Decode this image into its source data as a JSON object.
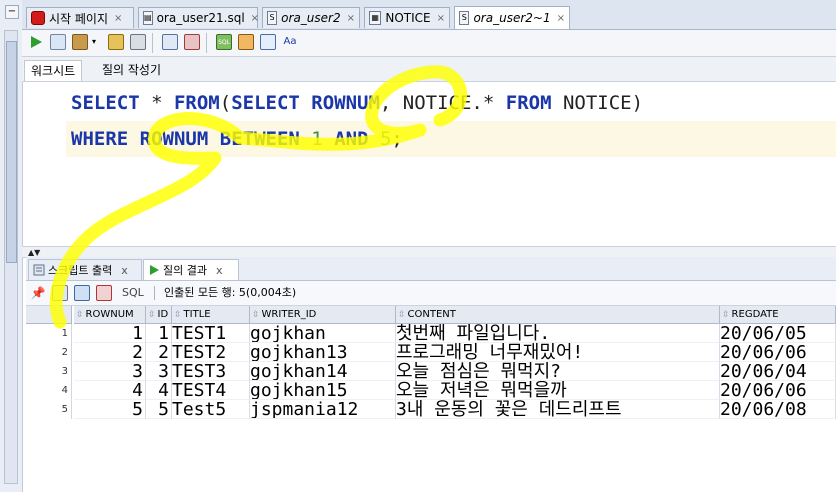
{
  "tabs": [
    {
      "label": "시작 페이지",
      "icon": "oracle-icon",
      "active": false,
      "italic": false
    },
    {
      "label": "ora_user21.sql",
      "icon": "sql-file-icon",
      "active": false,
      "italic": false
    },
    {
      "label": "ora_user2",
      "icon": "sql-worksheet-icon",
      "active": false,
      "italic": true
    },
    {
      "label": "NOTICE",
      "icon": "table-icon",
      "active": false,
      "italic": false
    },
    {
      "label": "ora_user2~1",
      "icon": "sql-worksheet-icon",
      "active": true,
      "italic": true
    }
  ],
  "subtabs": [
    "워크시트",
    "질의 작성기"
  ],
  "editor": {
    "line1": [
      {
        "t": "SELECT",
        "c": "kw"
      },
      {
        "t": " * ",
        "c": "plain"
      },
      {
        "t": "FROM",
        "c": "kw"
      },
      {
        "t": "(",
        "c": "plain"
      },
      {
        "t": "SELECT",
        "c": "kw"
      },
      {
        "t": " ",
        "c": "plain"
      },
      {
        "t": "ROWNUM",
        "c": "kw"
      },
      {
        "t": ", NOTICE.* ",
        "c": "plain"
      },
      {
        "t": "FROM",
        "c": "kw"
      },
      {
        "t": " NOTICE)",
        "c": "plain"
      }
    ],
    "line2": [
      {
        "t": "WHERE",
        "c": "kw"
      },
      {
        "t": " ",
        "c": "plain"
      },
      {
        "t": "ROWNUM",
        "c": "kw"
      },
      {
        "t": " ",
        "c": "plain"
      },
      {
        "t": "BETWEEN",
        "c": "kw"
      },
      {
        "t": " ",
        "c": "plain"
      },
      {
        "t": "1",
        "c": "num"
      },
      {
        "t": " ",
        "c": "plain"
      },
      {
        "t": "AND",
        "c": "kw"
      },
      {
        "t": " ",
        "c": "plain"
      },
      {
        "t": "5",
        "c": "num"
      },
      {
        "t": ";",
        "c": "plain"
      }
    ]
  },
  "result_tabs": [
    {
      "label": "스크립트 출력",
      "close": "x"
    },
    {
      "label": "질의 결과",
      "close": "x"
    }
  ],
  "results_toolbar": {
    "sql_label": "SQL",
    "status": "인출된 모든 행: 5(0,004초)"
  },
  "grid": {
    "columns": [
      "ROWNUM",
      "ID",
      "TITLE",
      "WRITER_ID",
      "CONTENT",
      "REGDATE"
    ],
    "rows": [
      {
        "n": "1",
        "cells": [
          "1",
          "1",
          "TEST1",
          "gojkhan",
          "첫번째 파일입니다.",
          "20/06/05"
        ]
      },
      {
        "n": "2",
        "cells": [
          "2",
          "2",
          "TEST2",
          "gojkhan13",
          "프로그래밍 너무재밌어!",
          "20/06/06"
        ]
      },
      {
        "n": "3",
        "cells": [
          "3",
          "3",
          "TEST3",
          "gojkhan14",
          "오늘 점심은 뭐먹지?",
          "20/06/04"
        ]
      },
      {
        "n": "4",
        "cells": [
          "4",
          "4",
          "TEST4",
          "gojkhan15",
          "오늘 저녁은 뭐먹을까",
          "20/06/06"
        ]
      },
      {
        "n": "5",
        "cells": [
          "5",
          "5",
          "Test5",
          "jspmania12",
          "3내 운동의 꽃은 데드리프트",
          "20/06/08"
        ]
      }
    ]
  },
  "colors": {
    "keyword": "#1a36a8",
    "number": "#3c8f3c",
    "highlight": "#ffff00",
    "current_line": "#fdf8e4"
  }
}
